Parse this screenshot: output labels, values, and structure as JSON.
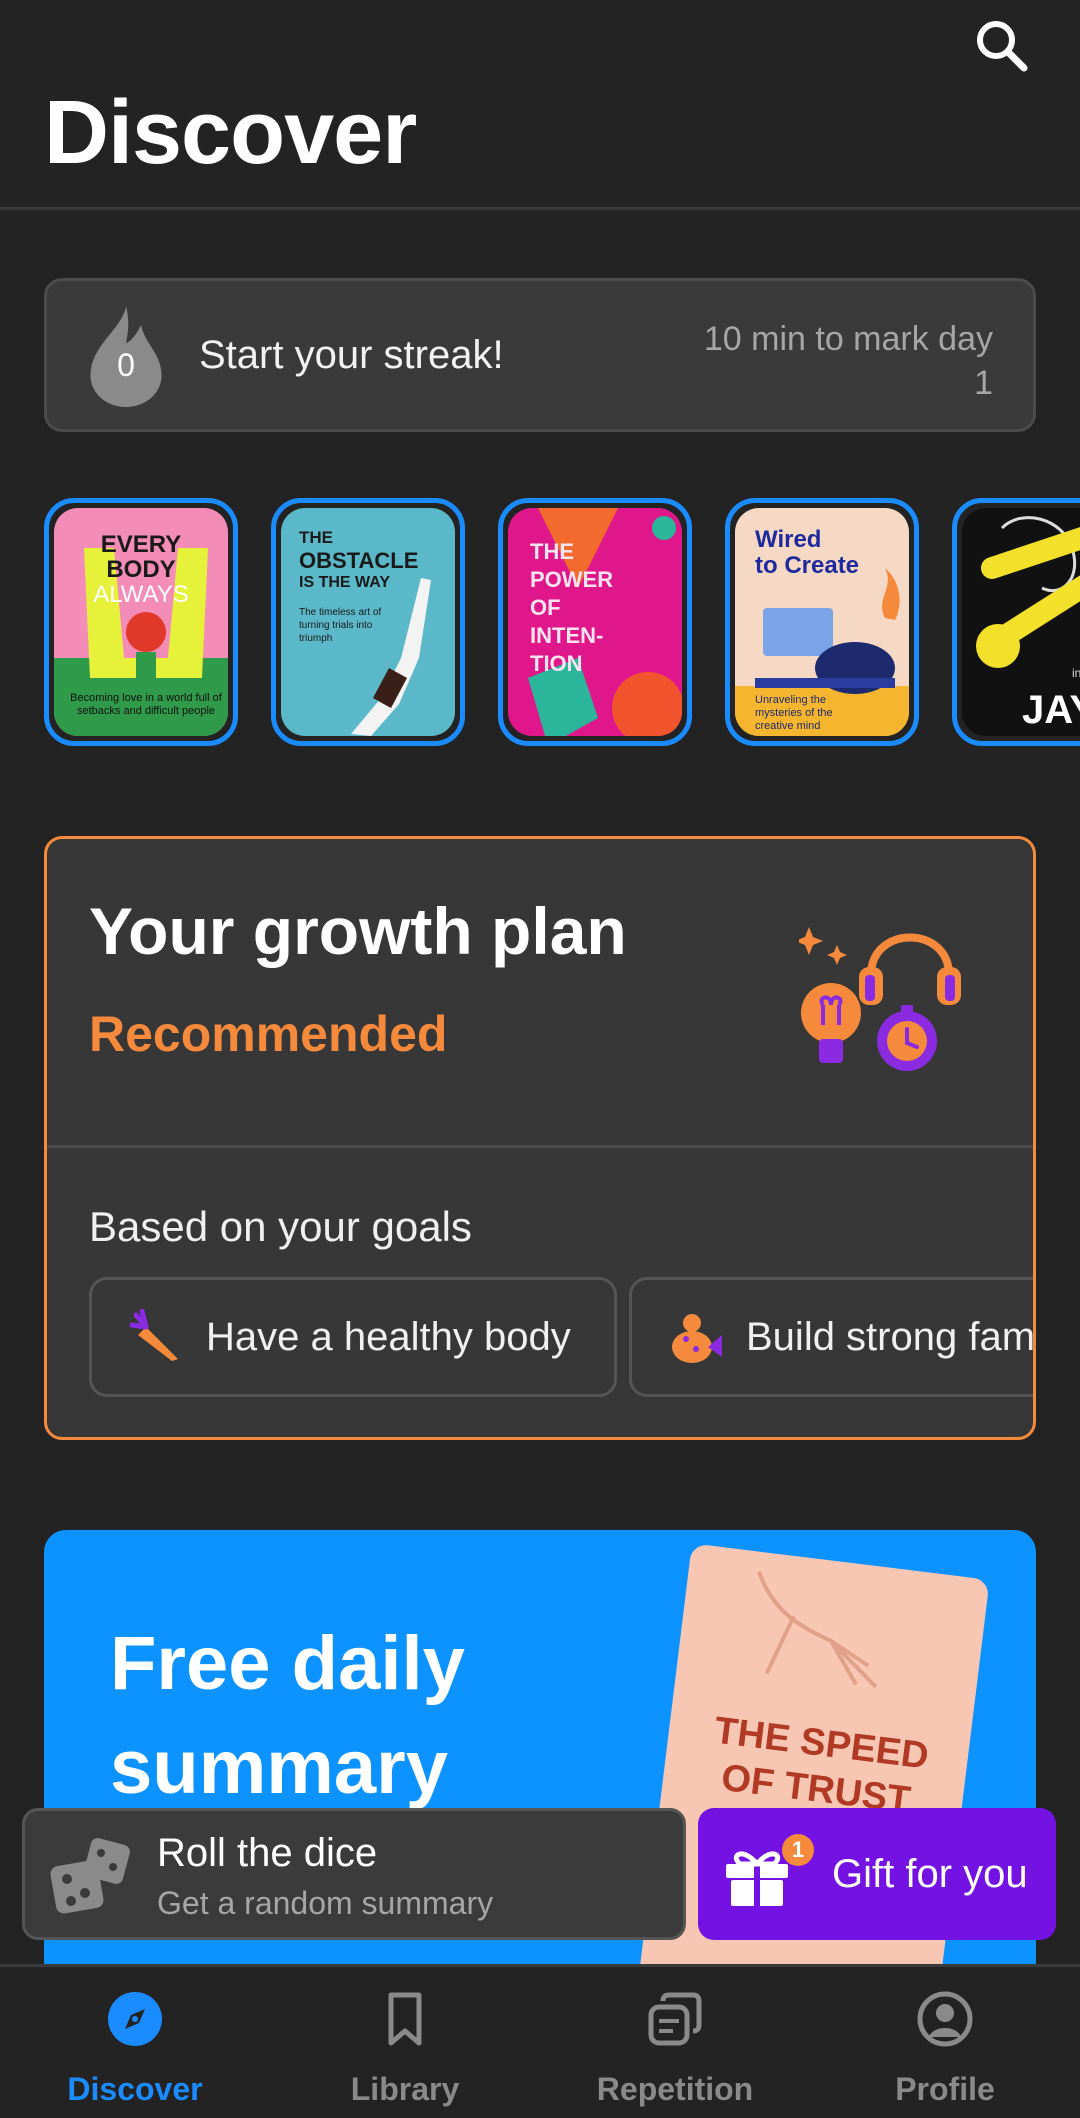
{
  "header": {
    "title": "Discover"
  },
  "streak": {
    "count": "0",
    "title": "Start your streak!",
    "note": "10 min to mark day 1"
  },
  "covers": [
    {
      "lines": [
        "EVERY",
        "BODY",
        "ALWAYS"
      ],
      "subtitle": "Becoming love in a world full of setbacks and difficult people",
      "bg": "#f48cb8"
    },
    {
      "lines": [
        "THE",
        "OBSTACLE",
        "IS THE WAY"
      ],
      "subtitle": "The timeless art of turning trials into triumph",
      "bg": "#5ab8c8"
    },
    {
      "lines": [
        "THE",
        "POWER",
        "OF",
        "INTEN-",
        "TION"
      ],
      "subtitle": "",
      "bg": "#e0178a"
    },
    {
      "lines": [
        "Wired",
        "to Create"
      ],
      "subtitle": "Unraveling the mysteries of the creative mind",
      "bg": "#f5d9c4"
    },
    {
      "lines": [
        "JAY"
      ],
      "subtitle": "in A",
      "bg": "#111111"
    }
  ],
  "plan": {
    "title": "Your growth plan",
    "subtitle": "Recommended",
    "goals_title": "Based on your goals",
    "goals": [
      {
        "label": "Have a healthy body",
        "icon": "carrot-icon"
      },
      {
        "label": "Build strong family",
        "icon": "family-icon"
      }
    ]
  },
  "promo": {
    "title": "Free daily summary",
    "book_title": "THE SPEED OF TRUST"
  },
  "dice": {
    "title": "Roll the dice",
    "subtitle": "Get a random summary"
  },
  "gift": {
    "label": "Gift for you",
    "badge": "1"
  },
  "tabs": [
    {
      "label": "Discover",
      "icon": "compass-icon"
    },
    {
      "label": "Library",
      "icon": "bookmark-icon"
    },
    {
      "label": "Repetition",
      "icon": "cards-icon"
    },
    {
      "label": "Profile",
      "icon": "profile-icon"
    }
  ],
  "colors": {
    "accent": "#1a8cff",
    "orange": "#f58a3c",
    "purple": "#7412e3",
    "promo_blue": "#0c93ff",
    "background": "#232323"
  }
}
